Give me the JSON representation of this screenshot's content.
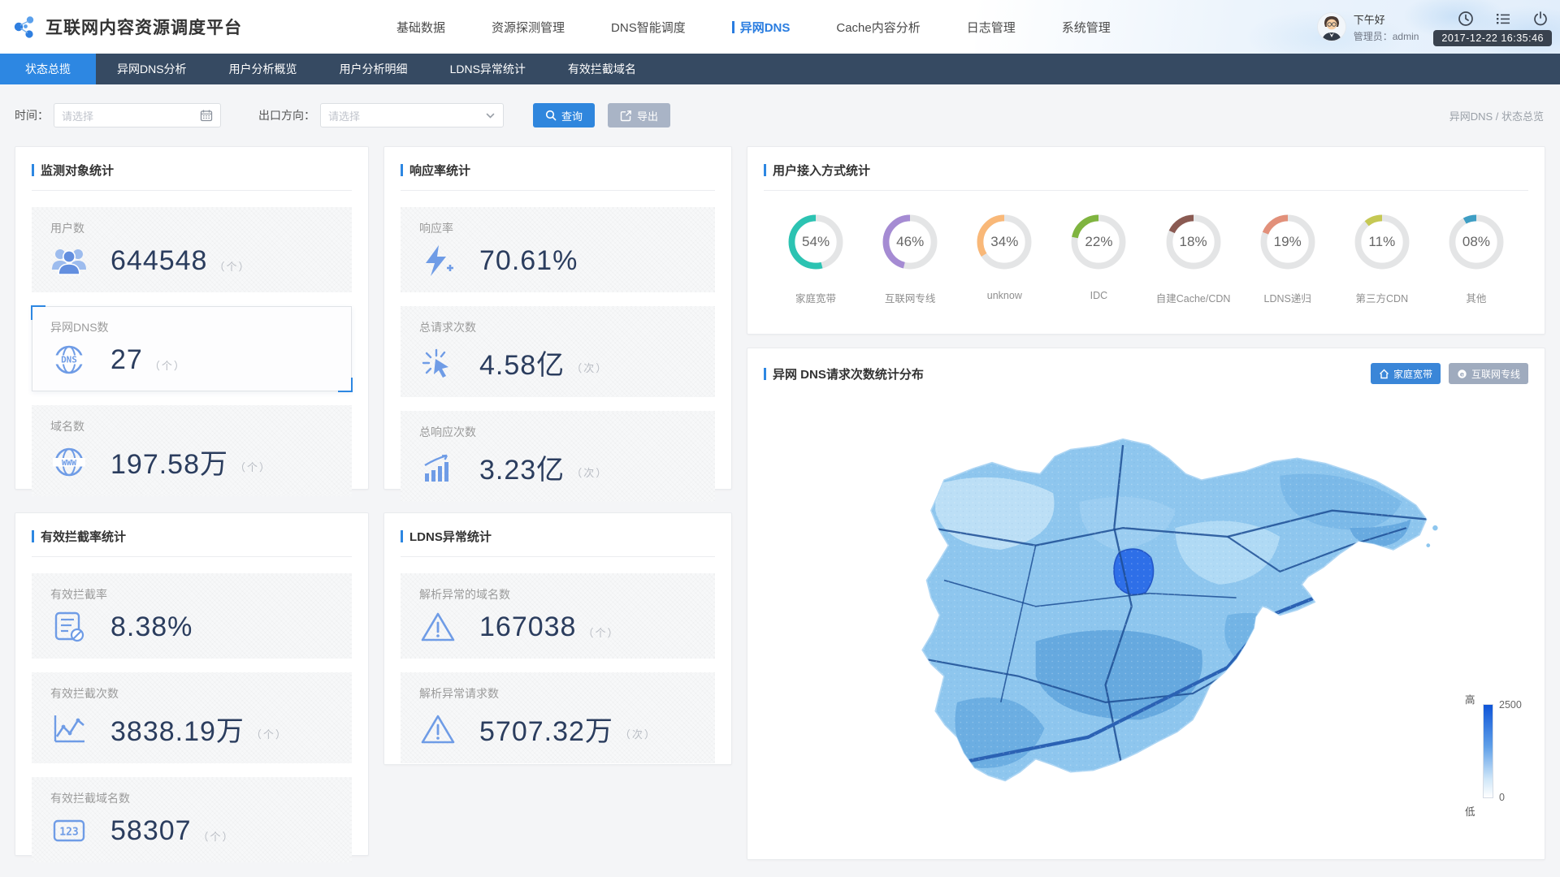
{
  "header": {
    "title": "互联网内容资源调度平台",
    "nav": [
      {
        "label": "基础数据"
      },
      {
        "label": "资源探测管理"
      },
      {
        "label": "DNS智能调度"
      },
      {
        "label": "异网DNS"
      },
      {
        "label": "Cache内容分析"
      },
      {
        "label": "日志管理"
      },
      {
        "label": "系统管理"
      }
    ],
    "greeting": "下午好",
    "admin": "管理员：admin",
    "datetime": "2017-12-22 16:35:46"
  },
  "tabs": [
    {
      "label": "状态总揽"
    },
    {
      "label": "异网DNS分析"
    },
    {
      "label": "用户分析概览"
    },
    {
      "label": "用户分析明细"
    },
    {
      "label": "LDNS异常统计"
    },
    {
      "label": "有效拦截域名"
    }
  ],
  "filter": {
    "time_label": "时间：",
    "time_placeholder": "请选择",
    "direction_label": "出口方向：",
    "direction_placeholder": "请选择",
    "query": "查询",
    "export": "导出",
    "breadcrumb": "异网DNS / 状态总览"
  },
  "cards": {
    "monitor": {
      "title": "监测对象统计",
      "stats": [
        {
          "label": "用户数",
          "value": "644548",
          "unit": "（个）"
        },
        {
          "label": "异网DNS数",
          "value": "27",
          "unit": "（个）"
        },
        {
          "label": "域名数",
          "value": "197.58万",
          "unit": "（个）"
        }
      ]
    },
    "response": {
      "title": "响应率统计",
      "stats": [
        {
          "label": "响应率",
          "value": "70.61%",
          "unit": ""
        },
        {
          "label": "总请求次数",
          "value": "4.58亿",
          "unit": "（次）"
        },
        {
          "label": "总响应次数",
          "value": "3.23亿",
          "unit": "（次）"
        }
      ]
    },
    "access": {
      "title": "用户接入方式统计"
    },
    "map": {
      "title": "异网 DNS请求次数统计分布",
      "buttons": [
        {
          "label": "家庭宽带"
        },
        {
          "label": "互联网专线"
        }
      ],
      "legend": {
        "high": "高",
        "low": "低",
        "max": "2500",
        "min": "0"
      }
    },
    "intercept": {
      "title": "有效拦截率统计",
      "stats": [
        {
          "label": "有效拦截率",
          "value": "8.38%",
          "unit": ""
        },
        {
          "label": "有效拦截次数",
          "value": "3838.19万",
          "unit": "（个）"
        },
        {
          "label": "有效拦截域名数",
          "value": "58307",
          "unit": "（个）"
        }
      ]
    },
    "ldns": {
      "title": "LDNS异常统计",
      "stats": [
        {
          "label": "解析异常的域名数",
          "value": "167038",
          "unit": "（个）"
        },
        {
          "label": "解析异常请求数",
          "value": "5707.32万",
          "unit": "（次）"
        }
      ]
    }
  },
  "chart_data": [
    {
      "type": "pie",
      "title": "用户接入方式统计",
      "series": [
        {
          "label": "家庭宽带",
          "percent": 54,
          "text": "54%",
          "color": "#2cc3b2"
        },
        {
          "label": "互联网专线",
          "percent": 46,
          "text": "46%",
          "color": "#a58bd3"
        },
        {
          "label": "unknow",
          "percent": 34,
          "text": "34%",
          "color": "#f9b878"
        },
        {
          "label": "IDC",
          "percent": 22,
          "text": "22%",
          "color": "#7fb43f"
        },
        {
          "label": "自建Cache/CDN",
          "percent": 18,
          "text": "18%",
          "color": "#8a5a52"
        },
        {
          "label": "LDNS递归",
          "percent": 19,
          "text": "19%",
          "color": "#e2907a"
        },
        {
          "label": "第三方CDN",
          "percent": 11,
          "text": "11%",
          "color": "#c5c853"
        },
        {
          "label": "其他",
          "percent": 8,
          "text": "08%",
          "color": "#3e9ec4"
        }
      ],
      "legend_position": "below-each-donut",
      "note": "donut gauges, arc starts at 12 o'clock sweeping counterclockwise"
    },
    {
      "type": "heatmap",
      "title": "异网 DNS请求次数统计分布",
      "region": "山东省",
      "value_range": [
        0,
        2500
      ],
      "legend": {
        "high_label": "高",
        "low_label": "低",
        "max": 2500,
        "min": 0
      }
    }
  ]
}
